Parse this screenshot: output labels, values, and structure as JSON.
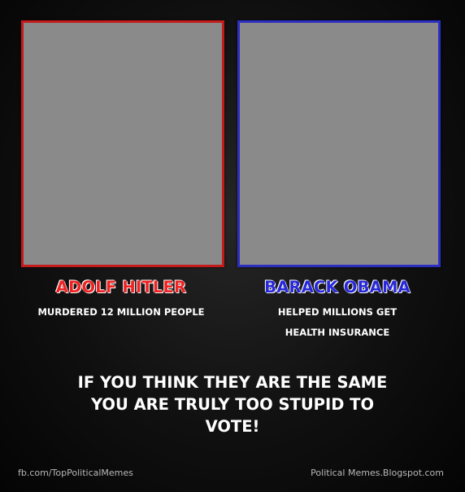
{
  "left": {
    "name": "ADOLF HITLER",
    "caption_lines": [
      "MURDERED 12 MILLION PEOPLE"
    ],
    "border_color": "#c41a1a",
    "name_color": "#ee2222"
  },
  "right": {
    "name": "BARACK OBAMA",
    "caption_lines": [
      "HELPED MILLIONS GET",
      "HEALTH INSURANCE"
    ],
    "border_color": "#2c2ec2",
    "name_color": "#2828d8"
  },
  "headline_lines": [
    "IF YOU THINK THEY ARE THE SAME",
    "YOU ARE TRULY TOO STUPID TO",
    "VOTE!"
  ],
  "footer": {
    "left": "fb.com/TopPoliticalMemes",
    "right": "Political Memes.Blogspot.com"
  }
}
